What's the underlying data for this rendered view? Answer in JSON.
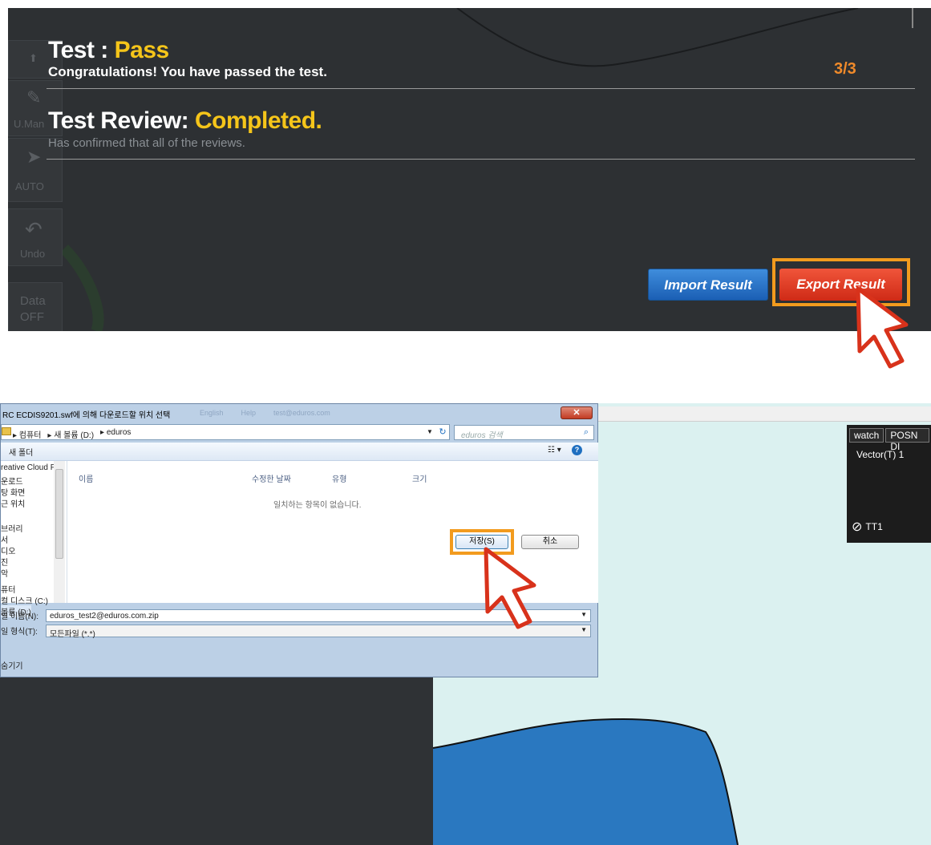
{
  "top_panel": {
    "toolbar_labels": [
      "U.Man",
      "AUTO",
      "Undo",
      "Data",
      "OFF"
    ],
    "test_label": "Test :",
    "test_status": "Pass",
    "test_message": "Congratulations! You have passed the test.",
    "page_count": "3/3",
    "review_label": "Test Review:",
    "review_status": "Completed.",
    "review_message": "Has confirmed that all of the reviews.",
    "import_button": "Import Result",
    "export_button": "Export Result",
    "colors": {
      "status_yellow": "#f5c51a",
      "highlight_orange": "#f29b1e",
      "export_red": "#d8321b",
      "import_blue": "#1f6fc4",
      "count_orange": "#f08a2a"
    }
  },
  "dialog": {
    "title": "RC ECDIS9201.swf에 의해 다운로드할 위치 선택",
    "faded_title_items": [
      "English",
      "Help",
      "test@eduros.com"
    ],
    "breadcrumb": [
      "▸ 컴퓨터",
      "▸ 새 볼륨 (D:)",
      "▸ eduros"
    ],
    "search_placeholder": "eduros 검색",
    "new_folder": "새 폴더",
    "view_icon": "view-options-icon",
    "help_icon": "help-icon",
    "nav_items": [
      "reative Cloud F",
      "운로드",
      "탕 화면",
      "근 위치",
      "",
      "브러리",
      "서",
      "디오",
      "진",
      "악",
      "",
      "퓨터",
      "컬 디스크 (C:)",
      "볼륨 (D:)"
    ],
    "columns": [
      "이름",
      "수정한 날짜",
      "유형",
      "크기"
    ],
    "empty_message": "일치하는 항목이 없습니다.",
    "filename_label": "일 이름(N):",
    "filename_value": "eduros_test2@eduros.com.zip",
    "filetype_label": "일 형식(T):",
    "filetype_value": "모든파일 (*.*)",
    "hide_folders": "숨기기",
    "save_button": "저장(S)",
    "cancel_button": "취소"
  },
  "map_panel": {
    "tabs": [
      "watch",
      "POSN DI"
    ],
    "vector_label": "Vector(T) 1",
    "target_label": "TT1",
    "colors": {
      "sea": "#dbf1f0",
      "land": "#2f3235"
    }
  }
}
